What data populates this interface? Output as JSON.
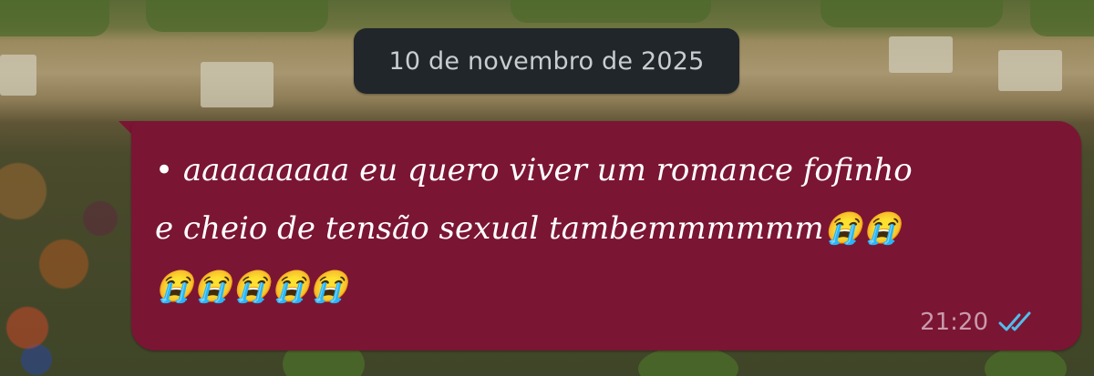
{
  "chat": {
    "date_separator": "10 de novembro de 2025",
    "message": {
      "text": "• aaaaaaaaa eu quero viver um romance fofinho\ne cheio de tensão sexual tambemmmmmm😭😭\n😭😭😭😭😭",
      "time": "21:20",
      "status_icon": "double-check-read-icon",
      "bubble_color": "#7b1534",
      "ticks_color": "#53bdeb"
    }
  }
}
